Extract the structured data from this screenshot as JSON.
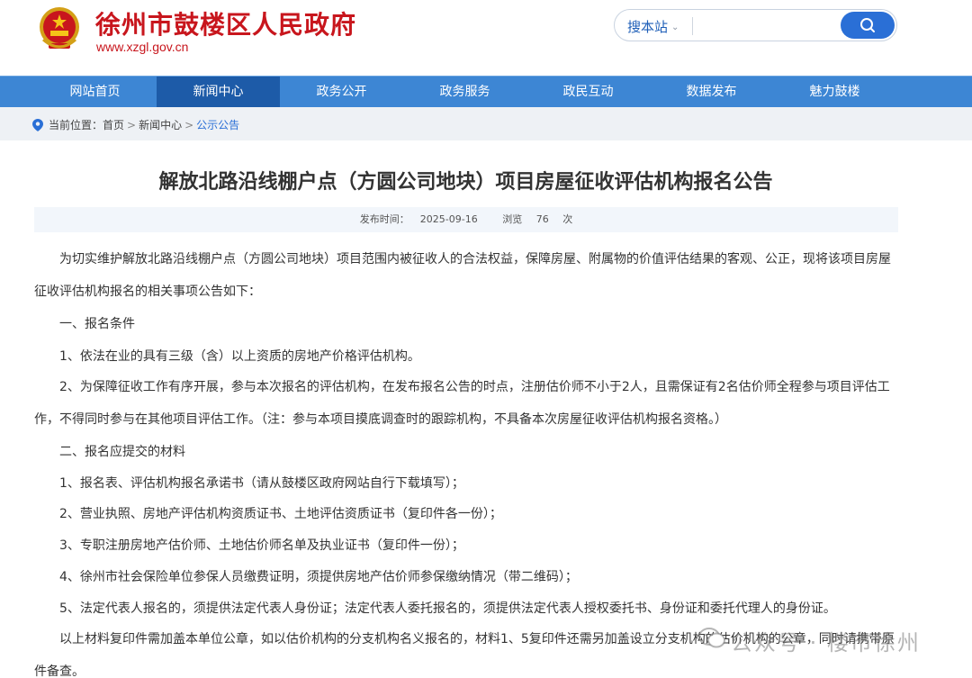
{
  "header": {
    "site_name": "徐州市鼓楼区人民政府",
    "site_url": "www.xzgl.gov.cn",
    "search_scope": "搜本站",
    "search_placeholder": ""
  },
  "nav": {
    "items": [
      {
        "label": "网站首页"
      },
      {
        "label": "新闻中心"
      },
      {
        "label": "政务公开"
      },
      {
        "label": "政务服务"
      },
      {
        "label": "政民互动"
      },
      {
        "label": "数据发布"
      },
      {
        "label": "魅力鼓楼"
      }
    ],
    "active_index": 1
  },
  "breadcrumb": {
    "prefix": "当前位置：",
    "items": [
      "首页",
      "新闻中心",
      "公示公告"
    ],
    "separator": ">"
  },
  "article": {
    "title": "解放北路沿线棚户点（方圆公司地块）项目房屋征收评估机构报名公告",
    "publish_label": "发布时间：",
    "publish_date": "2025-09-16",
    "views_label": "浏览",
    "views_count": "76",
    "views_unit": "次",
    "paragraphs": [
      "为切实维护解放北路沿线棚户点（方圆公司地块）项目范围内被征收人的合法权益，保障房屋、附属物的价值评估结果的客观、公正，现将该项目房屋征收评估机构报名的相关事项公告如下：",
      "一、报名条件",
      "1、依法在业的具有三级（含）以上资质的房地产价格评估机构。",
      "2、为保障征收工作有序开展，参与本次报名的评估机构，在发布报名公告的时点，注册估价师不小于2人，且需保证有2名估价师全程参与项目评估工作，不得同时参与在其他项目评估工作。（注：参与本项目摸底调查时的跟踪机构，不具备本次房屋征收评估机构报名资格。）",
      "二、报名应提交的材料",
      "1、报名表、评估机构报名承诺书（请从鼓楼区政府网站自行下载填写）；",
      "2、营业执照、房地产评估机构资质证书、土地评估资质证书（复印件各一份）；",
      "3、专职注册房地产估价师、土地估价师名单及执业证书（复印件一份）；",
      "4、徐州市社会保险单位参保人员缴费证明，须提供房地产估价师参保缴纳情况（带二维码）；",
      "5、法定代表人报名的，须提供法定代表人身份证；法定代表人委托报名的，须提供法定代表人授权委托书、身份证和委托代理人的身份证。",
      "以上材料复印件需加盖本单位公章，如以估价机构的分支机构名义报名的，材料1、5复印件还需另加盖设立分支机构的估价机构的公章，同时请携带原件备查。"
    ]
  },
  "watermark": {
    "text": "公众号 · 楼市徐州"
  },
  "colors": {
    "brand_red": "#c8161d",
    "nav_blue": "#3d86d4",
    "nav_active": "#1d5ba8",
    "search_blue": "#2a6fd6"
  }
}
